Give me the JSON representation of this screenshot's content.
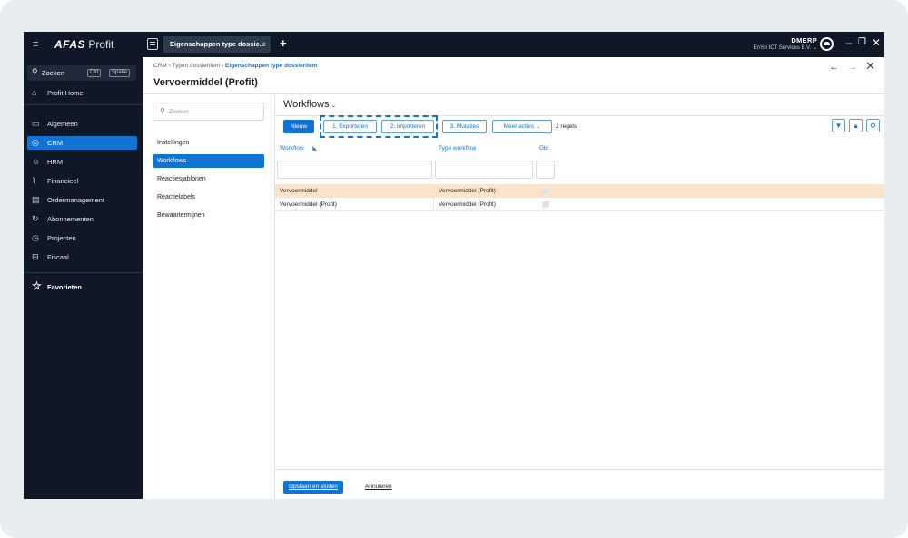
{
  "topbar": {
    "app_logo_bold": "AFAS",
    "app_logo_rest": "Profit",
    "tab_title": "Eigenschappen type dossie...",
    "tab_close": "×",
    "add_tab": "+",
    "user_name": "DMERP",
    "company": "EnYoi ICT Services B.V.",
    "company_caret": "⌄",
    "minimize": "–",
    "restore": "❐",
    "close": "✕"
  },
  "sidebar": {
    "search_label": "Zoeken",
    "shortcut_ctrl": "Ctrl",
    "shortcut_space": "Spatie",
    "home": "Profit Home",
    "items": [
      {
        "label": "Algemeen",
        "icon": "window-icon"
      },
      {
        "label": "CRM",
        "icon": "crm-icon"
      },
      {
        "label": "HRM",
        "icon": "people-icon"
      },
      {
        "label": "Financieel",
        "icon": "chart-icon"
      },
      {
        "label": "Ordermanagement",
        "icon": "cart-icon"
      },
      {
        "label": "Abonnementen",
        "icon": "refresh-icon"
      },
      {
        "label": "Projecten",
        "icon": "stopwatch-icon"
      },
      {
        "label": "Fiscaal",
        "icon": "fiscal-icon"
      }
    ],
    "favorites": "Favorieten"
  },
  "breadcrumb": {
    "part1": "CRM",
    "part2": "Typen dossieritem",
    "current": "Eigenschappen type dossieritem",
    "separator": "›"
  },
  "page_title": "Vervoermiddel (Profit)",
  "panel": {
    "search_placeholder": "Zoeken",
    "items": [
      "Instellingen",
      "Workflows",
      "Reactiesjablonen",
      "Reactielabels",
      "Bewaartermijnen"
    ]
  },
  "content": {
    "title": "Workflows",
    "toolbar": {
      "new": "Nieuw",
      "export": "1. Exporteren",
      "import": "2. Importeren",
      "mutations": "3. Mutaties",
      "more": "Meer acties ⌄",
      "count": "2 regels"
    },
    "columns": [
      "Workflow",
      "Type workflow",
      "Gbl."
    ],
    "rows": [
      {
        "workflow": "Vervoermiddel",
        "type": "Vervoermiddel (Profit)"
      },
      {
        "workflow": "Vervoermiddel (Profit)",
        "type": "Vervoermiddel (Profit)"
      }
    ],
    "save_close": "Opslaan en sluiten",
    "cancel": "Annuleren"
  },
  "colors": {
    "accent": "#1173d4",
    "sidebar_bg": "#0f1827",
    "selected_row": "#fde3c8"
  }
}
